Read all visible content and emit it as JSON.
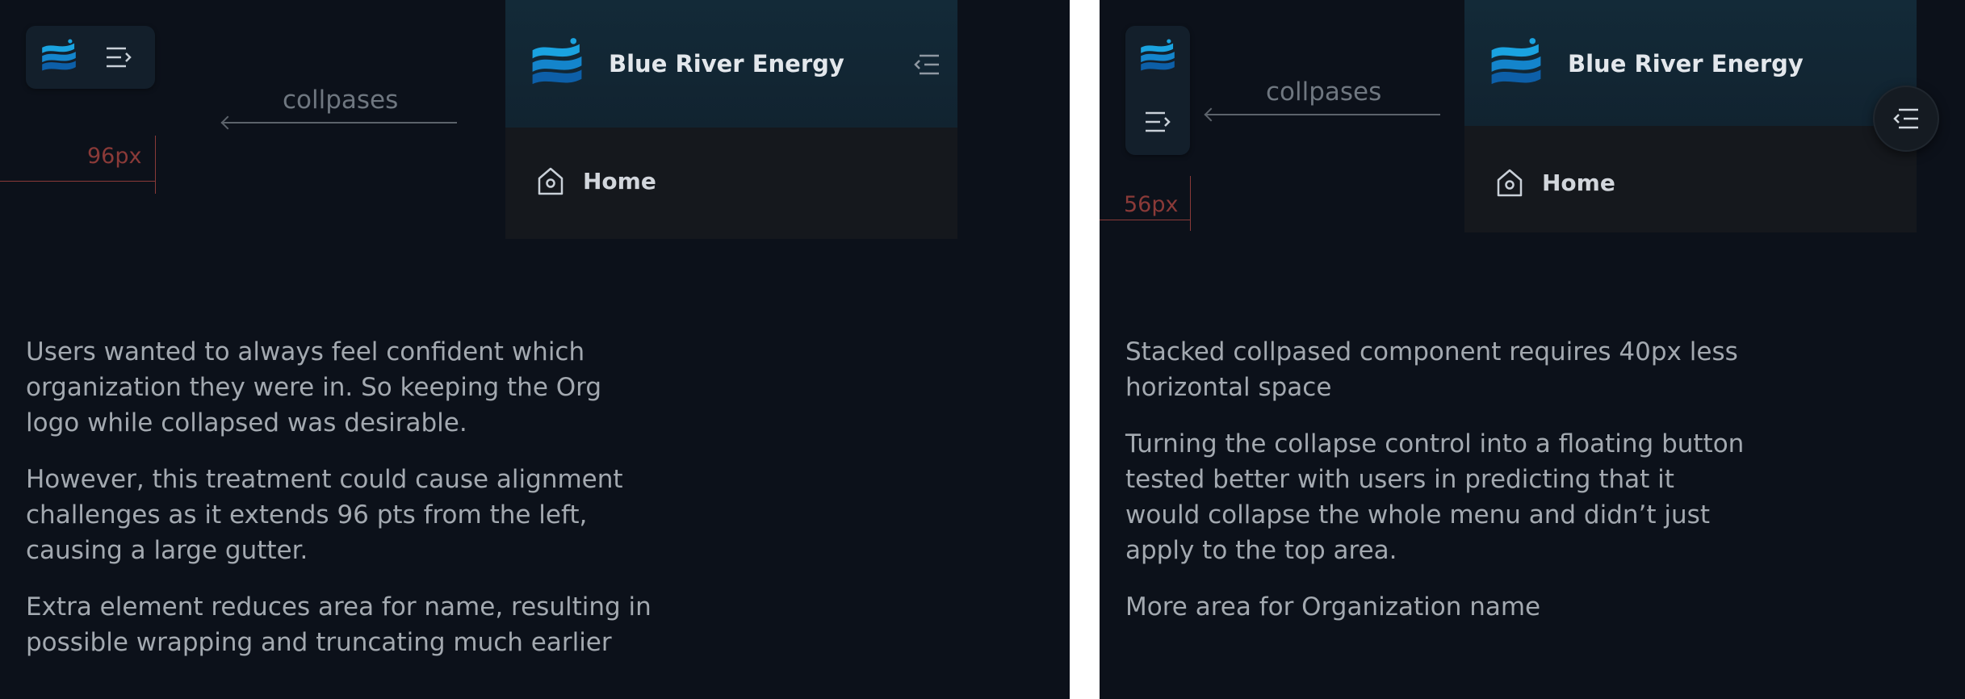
{
  "left_panel": {
    "annotation": "collpases",
    "measure_label": "96px",
    "brand_name": "Blue River Energy",
    "home_label": "Home",
    "paragraphs": [
      "Users wanted to always feel confident which organization they were in. So keeping the Org logo while collapsed was desirable.",
      "However, this treatment could cause alignment challenges as it extends 96 pts from the left, causing a large gutter.",
      "Extra element reduces area for name, resulting in possible wrapping and truncating much earlier"
    ]
  },
  "right_panel": {
    "annotation": "collpases",
    "measure_label": "56px",
    "brand_name": "Blue River Energy",
    "home_label": "Home",
    "paragraphs": [
      "Stacked collpased component requires 40px less horizontal space",
      "Turning the collapse control into a floating button tested better with users in predicting that it would collapse the whole menu and didn’t just apply to the top area.",
      "More area for Organization name"
    ]
  },
  "icons": {
    "logo": "blue-river-logo-icon",
    "expand": "expand-menu-icon",
    "collapse": "collapse-menu-icon",
    "home": "home-icon"
  },
  "colors": {
    "background": "#0c111a",
    "logo_light": "#1aa3e0",
    "logo_dark": "#0d5fa8",
    "measure": "#8a3a38",
    "text": "#a3a9b0"
  }
}
